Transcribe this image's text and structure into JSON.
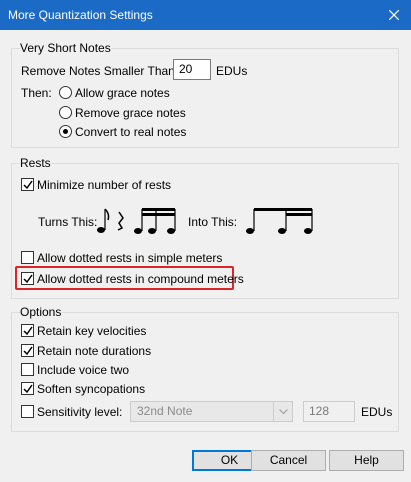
{
  "window": {
    "title": "More Quantization Settings",
    "close_glyph": "✕"
  },
  "very_short_notes": {
    "group_label": "Very Short Notes",
    "remove_label": "Remove Notes Smaller Than:",
    "remove_value": "20",
    "remove_unit": "EDUs",
    "then_label": "Then:",
    "options": [
      {
        "label": "Allow grace notes",
        "selected": false
      },
      {
        "label": "Remove grace notes",
        "selected": false
      },
      {
        "label": "Convert to real notes",
        "selected": true
      }
    ]
  },
  "rests": {
    "group_label": "Rests",
    "minimize": {
      "label": "Minimize number of rests",
      "checked": true
    },
    "turns_this_label": "Turns This:",
    "into_this_label": "Into This:",
    "dotted_simple": {
      "label": "Allow dotted rests in simple meters",
      "checked": false
    },
    "dotted_compound": {
      "label": "Allow dotted rests in compound meters",
      "checked": true
    }
  },
  "options": {
    "group_label": "Options",
    "retain_velocities": {
      "label": "Retain key velocities",
      "checked": true
    },
    "retain_durations": {
      "label": "Retain note durations",
      "checked": true
    },
    "include_voice_two": {
      "label": "Include voice two",
      "checked": false
    },
    "soften_syncopations": {
      "label": "Soften syncopations",
      "checked": true
    },
    "sensitivity": {
      "label": "Sensitivity level:",
      "checked": false,
      "select_value": "32nd Note",
      "value": "128",
      "unit": "EDUs"
    }
  },
  "buttons": {
    "ok": "OK",
    "cancel": "Cancel",
    "help": "Help"
  },
  "colors": {
    "title_bar": "#1b6bc6",
    "highlight": "#d9262b",
    "default_button_border": "#0078d7"
  }
}
